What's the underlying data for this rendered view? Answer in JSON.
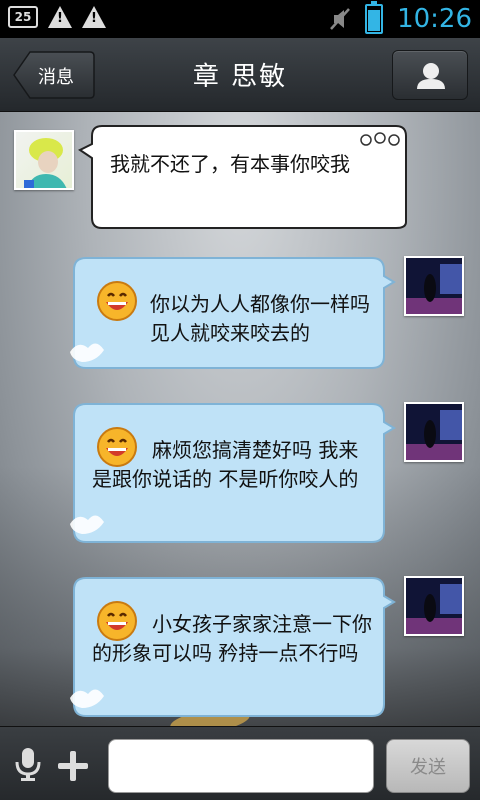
{
  "status_bar": {
    "badge": "25",
    "time": "10:26",
    "icons": [
      "sd-card-icon",
      "warning-icon",
      "warning-icon",
      "mute-icon",
      "battery-icon"
    ]
  },
  "header": {
    "back_label": "消息",
    "title": "章  思敏",
    "profile_icon": "person-icon"
  },
  "messages": [
    {
      "side": "left",
      "text": "我就不还了，有本事你咬我",
      "emoji": false
    },
    {
      "side": "right",
      "text": "你以为人人都像你一样吗 见人就咬来咬去的",
      "emoji": "smile-emoji"
    },
    {
      "side": "right",
      "text": "麻烦您搞清楚好吗 我来是跟你说话的 不是听你咬人的",
      "emoji": "smile-emoji"
    },
    {
      "side": "right",
      "text": "小女孩子家家注意一下你的形象可以吗 矜持一点不行吗",
      "emoji": "smile-emoji"
    }
  ],
  "input": {
    "placeholder": "",
    "send_label": "发送"
  },
  "colors": {
    "accent": "#33b5e5",
    "bubble_right": "#bfe2f7",
    "bubble_left": "#ffffff"
  }
}
